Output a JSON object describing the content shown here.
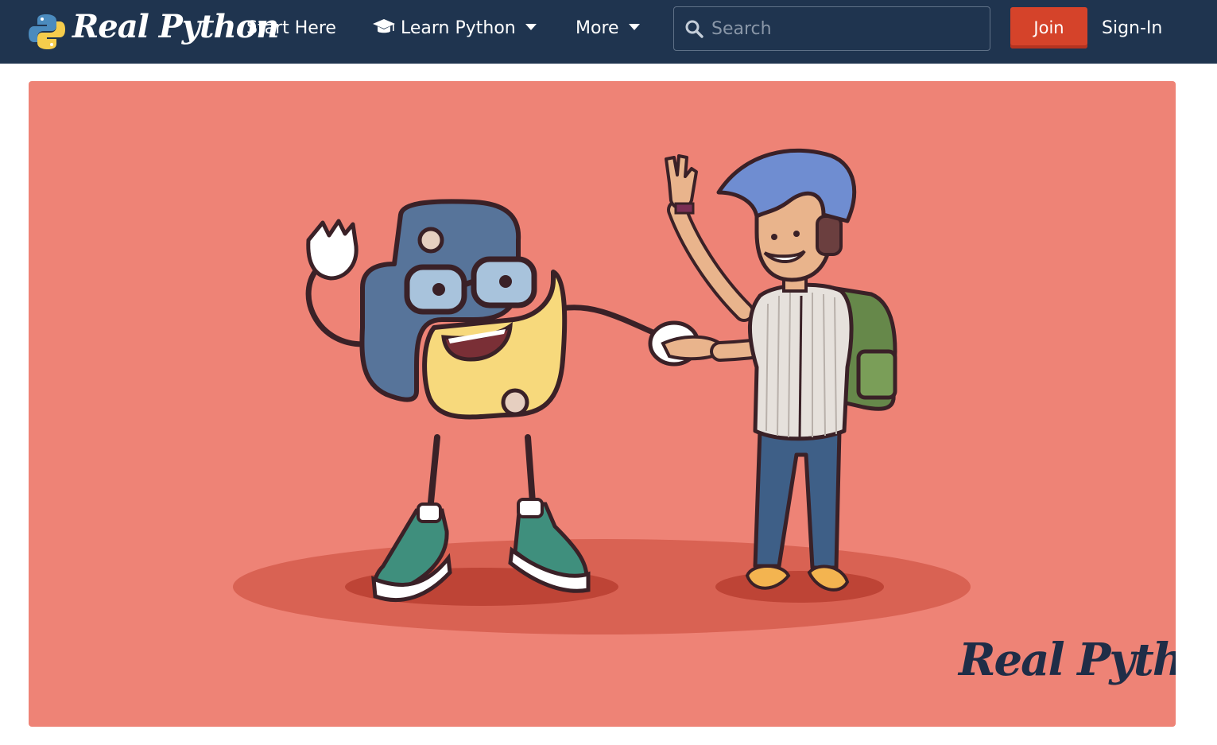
{
  "brand": {
    "name": "Real Python"
  },
  "nav": {
    "start_here": "Start Here",
    "learn_python": "Learn Python",
    "more": "More",
    "learn_icon": "graduation-cap-icon",
    "caret_icon": "caret-down-icon"
  },
  "search": {
    "placeholder": "Search",
    "icon": "search-icon"
  },
  "auth": {
    "join_label": "Join",
    "signin_label": "Sign-In"
  },
  "hero": {
    "watermark": "Real Python"
  },
  "colors": {
    "navbar": "#1f344f",
    "join": "#d5432a",
    "hero_bg": "#ee8376",
    "snake_blue": "#57749a",
    "snake_yellow": "#f7d97c"
  }
}
